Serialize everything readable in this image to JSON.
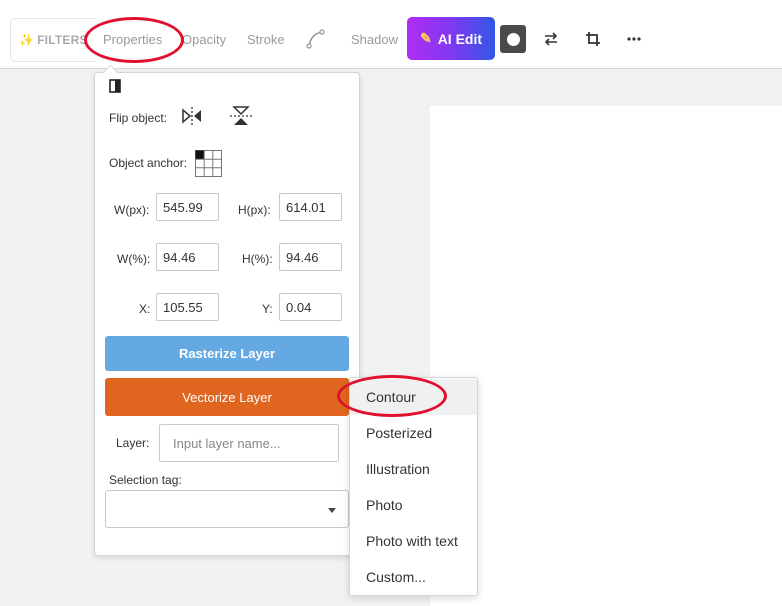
{
  "toolbar": {
    "filters_label": "FILTERS",
    "tabs": [
      "Properties",
      "Opacity",
      "Stroke",
      "Shadow"
    ],
    "ai_edit_label": "AI Edit"
  },
  "properties_panel": {
    "flip_label": "Flip object:",
    "anchor_label": "Object anchor:",
    "w_px_label": "W(px):",
    "w_px_value": "545.99",
    "h_px_label": "H(px):",
    "h_px_value": "614.01",
    "w_pct_label": "W(%):",
    "w_pct_value": "94.46",
    "h_pct_label": "H(%):",
    "h_pct_value": "94.46",
    "x_label": "X:",
    "x_value": "105.55",
    "y_label": "Y:",
    "y_value": "0.04",
    "rasterize_label": "Rasterize Layer",
    "vectorize_label": "Vectorize Layer",
    "layer_label": "Layer:",
    "layer_placeholder": "Input layer name...",
    "selection_tag_label": "Selection tag:"
  },
  "vectorize_menu": {
    "items": [
      "Contour",
      "Posterized",
      "Illustration",
      "Photo",
      "Photo with text",
      "Custom..."
    ]
  },
  "colors": {
    "rasterize": "#64a9e1",
    "vectorize": "#e0661f",
    "highlight": "#e0102f"
  }
}
